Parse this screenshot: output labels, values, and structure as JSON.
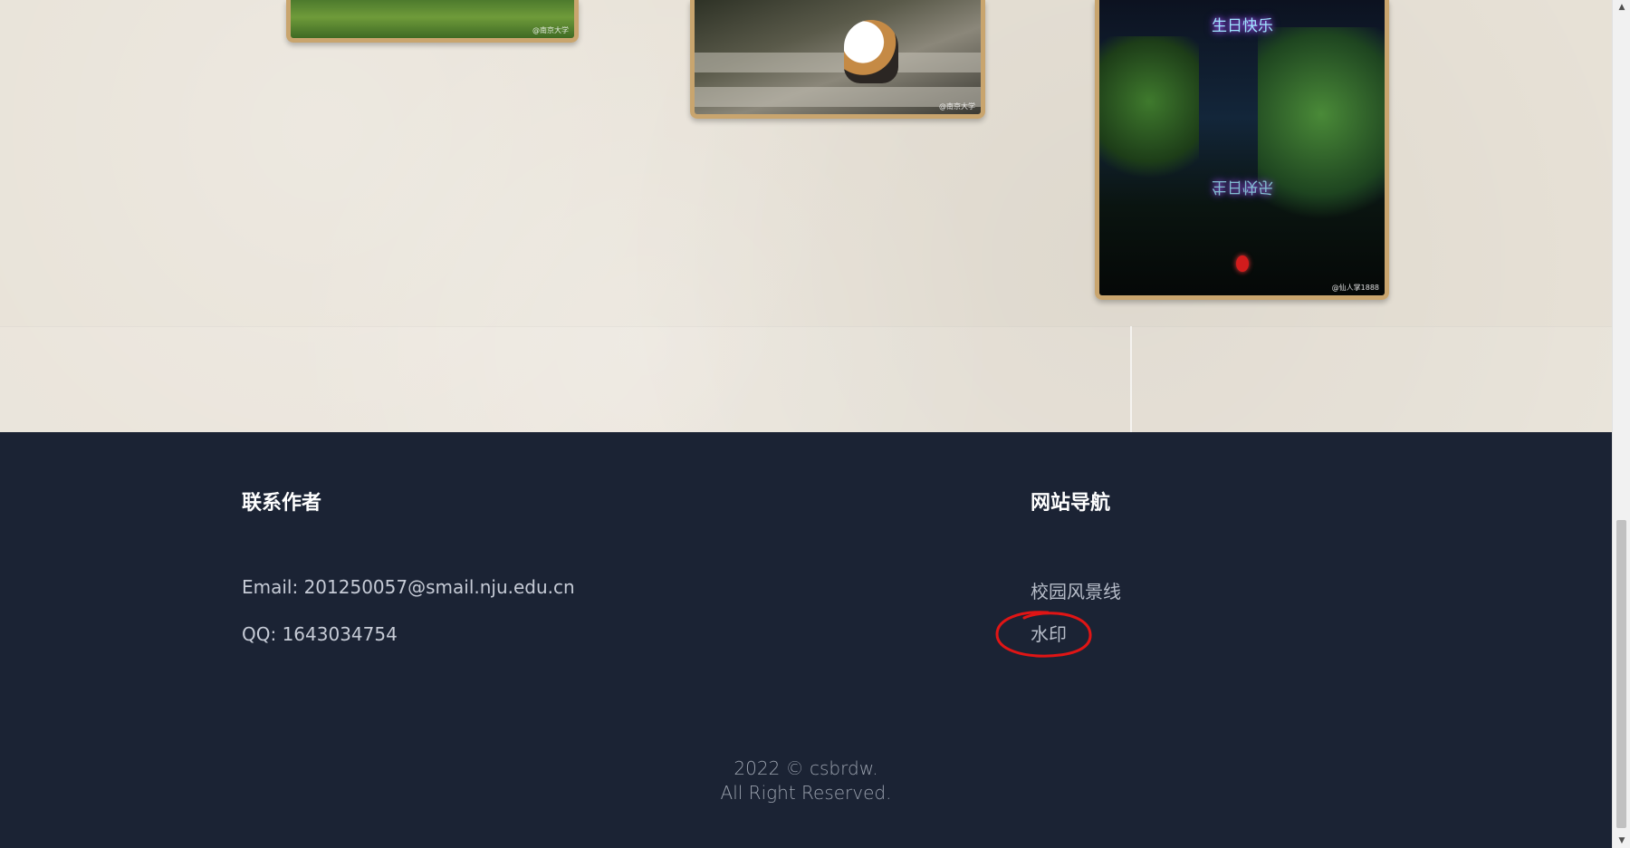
{
  "gallery": {
    "photos": [
      {
        "credit": "@南京大学"
      },
      {
        "credit": "@南京大学"
      },
      {
        "credit": "@仙人掌1888",
        "sign_text": "生日快乐",
        "reflection_text": "生日快乐"
      }
    ]
  },
  "footer": {
    "contact": {
      "title": "联系作者",
      "email": "Email: 201250057@smail.nju.edu.cn",
      "qq": "QQ: 1643034754"
    },
    "nav": {
      "title": "网站导航",
      "links": [
        "校园风景线",
        "水印"
      ]
    },
    "copyright": {
      "line1": "2022 © csbrdw.",
      "line2": "All Right Reserved."
    },
    "annotation_color": "#e01515"
  },
  "colors": {
    "footer_bg": "#1b2334",
    "gallery_bg": "#e7e1d6",
    "photo_frame": "#c9a56e"
  },
  "scrollbar": {
    "position_fraction": 0.62
  }
}
